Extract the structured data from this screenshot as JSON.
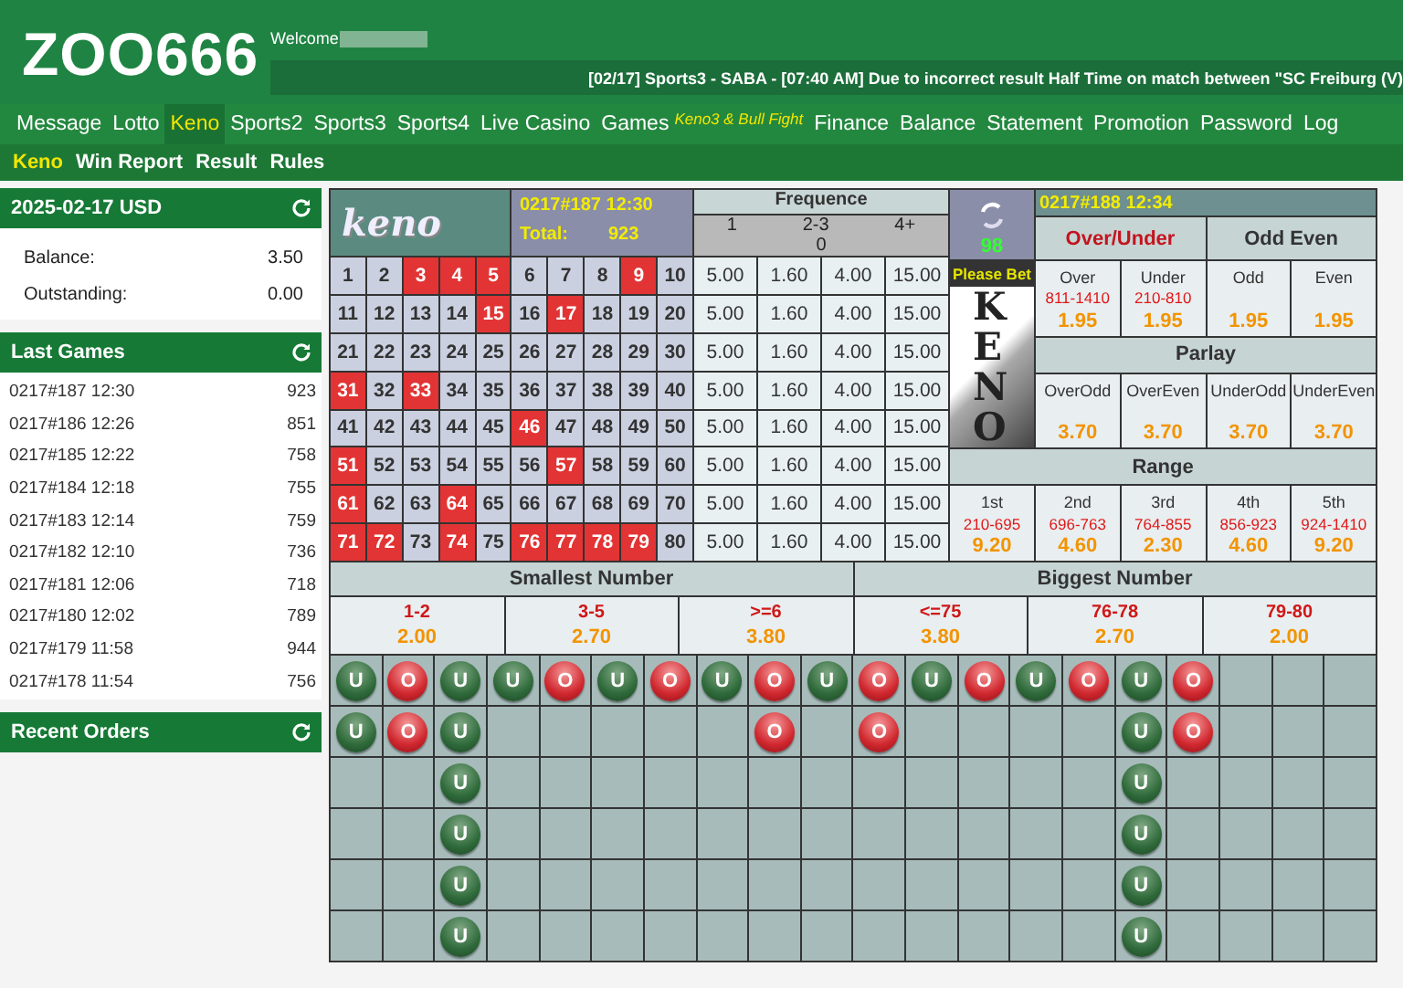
{
  "header": {
    "logo": "ZOO666",
    "welcome": "Welcome",
    "news": "[02/17] Sports3 - SABA - [07:40 AM] Due to incorrect result Half Time on match between \"SC Freiburg (V)"
  },
  "nav": [
    {
      "label": "Message",
      "selected": false
    },
    {
      "label": "Lotto",
      "selected": false
    },
    {
      "label": "Keno",
      "selected": true
    },
    {
      "label": "Sports2",
      "selected": false
    },
    {
      "label": "Sports3",
      "selected": false
    },
    {
      "label": "Sports4",
      "selected": false
    },
    {
      "label": "Live Casino",
      "selected": false
    },
    {
      "label": "Games",
      "selected": false,
      "note": "Keno3 & Bull Fight"
    },
    {
      "label": "Finance",
      "selected": false
    },
    {
      "label": "Balance",
      "selected": false
    },
    {
      "label": "Statement",
      "selected": false
    },
    {
      "label": "Promotion",
      "selected": false
    },
    {
      "label": "Password",
      "selected": false
    },
    {
      "label": "Log",
      "selected": false
    }
  ],
  "subnav": [
    {
      "label": "Keno",
      "selected": true
    },
    {
      "label": "Win Report",
      "selected": false
    },
    {
      "label": "Result",
      "selected": false
    },
    {
      "label": "Rules",
      "selected": false
    }
  ],
  "sidebar": {
    "account": {
      "title": "2025-02-17 USD",
      "rows": [
        {
          "label": "Balance:",
          "value": "3.50"
        },
        {
          "label": "Outstanding:",
          "value": "0.00"
        }
      ]
    },
    "last_games": {
      "title": "Last Games",
      "rows": [
        {
          "draw": "0217#187 12:30",
          "total": "923"
        },
        {
          "draw": "0217#186 12:26",
          "total": "851"
        },
        {
          "draw": "0217#185 12:22",
          "total": "758"
        },
        {
          "draw": "0217#184 12:18",
          "total": "755"
        },
        {
          "draw": "0217#183 12:14",
          "total": "759"
        },
        {
          "draw": "0217#182 12:10",
          "total": "736"
        },
        {
          "draw": "0217#181 12:06",
          "total": "718"
        },
        {
          "draw": "0217#180 12:02",
          "total": "789"
        },
        {
          "draw": "0217#179 11:58",
          "total": "944"
        },
        {
          "draw": "0217#178 11:54",
          "total": "756"
        }
      ]
    },
    "recent_orders": {
      "title": "Recent Orders"
    }
  },
  "board": {
    "logo": "keno",
    "current": {
      "draw": "0217#187 12:30",
      "total_label": "Total:",
      "total": "923"
    },
    "frequence": {
      "title": "Frequence",
      "columns": [
        "1",
        "2-3",
        "4+"
      ],
      "count": "0"
    },
    "numbers": [
      {
        "n": "1",
        "drawn": false
      },
      {
        "n": "2",
        "drawn": false
      },
      {
        "n": "3",
        "drawn": true
      },
      {
        "n": "4",
        "drawn": true
      },
      {
        "n": "5",
        "drawn": true
      },
      {
        "n": "6",
        "drawn": false
      },
      {
        "n": "7",
        "drawn": false
      },
      {
        "n": "8",
        "drawn": false
      },
      {
        "n": "9",
        "drawn": true
      },
      {
        "n": "10",
        "drawn": false
      },
      {
        "n": "11",
        "drawn": false
      },
      {
        "n": "12",
        "drawn": false
      },
      {
        "n": "13",
        "drawn": false
      },
      {
        "n": "14",
        "drawn": false
      },
      {
        "n": "15",
        "drawn": true
      },
      {
        "n": "16",
        "drawn": false
      },
      {
        "n": "17",
        "drawn": true
      },
      {
        "n": "18",
        "drawn": false
      },
      {
        "n": "19",
        "drawn": false
      },
      {
        "n": "20",
        "drawn": false
      },
      {
        "n": "21",
        "drawn": false
      },
      {
        "n": "22",
        "drawn": false
      },
      {
        "n": "23",
        "drawn": false
      },
      {
        "n": "24",
        "drawn": false
      },
      {
        "n": "25",
        "drawn": false
      },
      {
        "n": "26",
        "drawn": false
      },
      {
        "n": "27",
        "drawn": false
      },
      {
        "n": "28",
        "drawn": false
      },
      {
        "n": "29",
        "drawn": false
      },
      {
        "n": "30",
        "drawn": false
      },
      {
        "n": "31",
        "drawn": true
      },
      {
        "n": "32",
        "drawn": false
      },
      {
        "n": "33",
        "drawn": true
      },
      {
        "n": "34",
        "drawn": false
      },
      {
        "n": "35",
        "drawn": false
      },
      {
        "n": "36",
        "drawn": false
      },
      {
        "n": "37",
        "drawn": false
      },
      {
        "n": "38",
        "drawn": false
      },
      {
        "n": "39",
        "drawn": false
      },
      {
        "n": "40",
        "drawn": false
      },
      {
        "n": "41",
        "drawn": false
      },
      {
        "n": "42",
        "drawn": false
      },
      {
        "n": "43",
        "drawn": false
      },
      {
        "n": "44",
        "drawn": false
      },
      {
        "n": "45",
        "drawn": false
      },
      {
        "n": "46",
        "drawn": true
      },
      {
        "n": "47",
        "drawn": false
      },
      {
        "n": "48",
        "drawn": false
      },
      {
        "n": "49",
        "drawn": false
      },
      {
        "n": "50",
        "drawn": false
      },
      {
        "n": "51",
        "drawn": true
      },
      {
        "n": "52",
        "drawn": false
      },
      {
        "n": "53",
        "drawn": false
      },
      {
        "n": "54",
        "drawn": false
      },
      {
        "n": "55",
        "drawn": false
      },
      {
        "n": "56",
        "drawn": false
      },
      {
        "n": "57",
        "drawn": true
      },
      {
        "n": "58",
        "drawn": false
      },
      {
        "n": "59",
        "drawn": false
      },
      {
        "n": "60",
        "drawn": false
      },
      {
        "n": "61",
        "drawn": true
      },
      {
        "n": "62",
        "drawn": false
      },
      {
        "n": "63",
        "drawn": false
      },
      {
        "n": "64",
        "drawn": true
      },
      {
        "n": "65",
        "drawn": false
      },
      {
        "n": "66",
        "drawn": false
      },
      {
        "n": "67",
        "drawn": false
      },
      {
        "n": "68",
        "drawn": false
      },
      {
        "n": "69",
        "drawn": false
      },
      {
        "n": "70",
        "drawn": false
      },
      {
        "n": "71",
        "drawn": true
      },
      {
        "n": "72",
        "drawn": true
      },
      {
        "n": "73",
        "drawn": false
      },
      {
        "n": "74",
        "drawn": true
      },
      {
        "n": "75",
        "drawn": false
      },
      {
        "n": "76",
        "drawn": true
      },
      {
        "n": "77",
        "drawn": true
      },
      {
        "n": "78",
        "drawn": true
      },
      {
        "n": "79",
        "drawn": true
      },
      {
        "n": "80",
        "drawn": false
      }
    ],
    "odds_rows": [
      [
        "5.00",
        "1.60",
        "4.00",
        "15.00"
      ],
      [
        "5.00",
        "1.60",
        "4.00",
        "15.00"
      ],
      [
        "5.00",
        "1.60",
        "4.00",
        "15.00"
      ],
      [
        "5.00",
        "1.60",
        "4.00",
        "15.00"
      ],
      [
        "5.00",
        "1.60",
        "4.00",
        "15.00"
      ],
      [
        "5.00",
        "1.60",
        "4.00",
        "15.00"
      ],
      [
        "5.00",
        "1.60",
        "4.00",
        "15.00"
      ],
      [
        "5.00",
        "1.60",
        "4.00",
        "15.00"
      ]
    ],
    "next": {
      "draw": "0217#188 12:34",
      "countdown": "98",
      "status": "Please Bet",
      "logo_letters": "KENO"
    },
    "over_under": {
      "title": "Over/Under",
      "highlighted": true,
      "options": [
        {
          "label": "Over",
          "range": "811-1410",
          "odds": "1.95"
        },
        {
          "label": "Under",
          "range": "210-810",
          "odds": "1.95"
        }
      ]
    },
    "odd_even": {
      "title": "Odd Even",
      "highlighted": false,
      "options": [
        {
          "label": "Odd",
          "odds": "1.95"
        },
        {
          "label": "Even",
          "odds": "1.95"
        }
      ]
    },
    "parlay": {
      "title": "Parlay",
      "options": [
        {
          "label": "OverOdd",
          "odds": "3.70"
        },
        {
          "label": "OverEven",
          "odds": "3.70"
        },
        {
          "label": "UnderOdd",
          "odds": "3.70"
        },
        {
          "label": "UnderEven",
          "odds": "3.70"
        }
      ]
    },
    "range": {
      "title": "Range",
      "options": [
        {
          "label": "1st",
          "range": "210-695",
          "odds": "9.20"
        },
        {
          "label": "2nd",
          "range": "696-763",
          "odds": "4.60"
        },
        {
          "label": "3rd",
          "range": "764-855",
          "odds": "2.30"
        },
        {
          "label": "4th",
          "range": "856-923",
          "odds": "4.60"
        },
        {
          "label": "5th",
          "range": "924-1410",
          "odds": "9.20"
        }
      ]
    },
    "smallest": {
      "title": "Smallest Number",
      "options": [
        {
          "label": "1-2",
          "odds": "2.00"
        },
        {
          "label": "3-5",
          "odds": "2.70"
        },
        {
          "label": ">=6",
          "odds": "3.80"
        }
      ]
    },
    "biggest": {
      "title": "Biggest Number",
      "options": [
        {
          "label": "<=75",
          "odds": "3.80"
        },
        {
          "label": "76-78",
          "odds": "2.70"
        },
        {
          "label": "79-80",
          "odds": "2.00"
        }
      ]
    }
  },
  "road": [
    [
      {
        "label": "U",
        "kind": "under"
      },
      {
        "label": "U",
        "kind": "under"
      }
    ],
    [
      {
        "label": "O",
        "kind": "over"
      },
      {
        "label": "O",
        "kind": "over"
      }
    ],
    [
      {
        "label": "U",
        "kind": "under"
      },
      {
        "label": "U",
        "kind": "under"
      },
      {
        "label": "U",
        "kind": "under"
      },
      {
        "label": "U",
        "kind": "under"
      },
      {
        "label": "U",
        "kind": "under"
      },
      {
        "label": "U",
        "kind": "under"
      }
    ],
    [
      {
        "label": "U",
        "kind": "under"
      }
    ],
    [
      {
        "label": "O",
        "kind": "over"
      }
    ],
    [
      {
        "label": "U",
        "kind": "under"
      }
    ],
    [
      {
        "label": "O",
        "kind": "over"
      }
    ],
    [
      {
        "label": "U",
        "kind": "under"
      }
    ],
    [
      {
        "label": "O",
        "kind": "over"
      },
      {
        "label": "O",
        "kind": "over"
      }
    ],
    [
      {
        "label": "U",
        "kind": "under"
      }
    ],
    [
      {
        "label": "O",
        "kind": "over"
      },
      {
        "label": "O",
        "kind": "over"
      }
    ],
    [
      {
        "label": "U",
        "kind": "under"
      }
    ],
    [
      {
        "label": "O",
        "kind": "over"
      }
    ],
    [
      {
        "label": "U",
        "kind": "under"
      }
    ],
    [
      {
        "label": "O",
        "kind": "over"
      }
    ],
    [
      {
        "label": "U",
        "kind": "under"
      },
      {
        "label": "U",
        "kind": "under"
      },
      {
        "label": "U",
        "kind": "under"
      },
      {
        "label": "U",
        "kind": "under"
      },
      {
        "label": "U",
        "kind": "under"
      },
      {
        "label": "U",
        "kind": "under"
      }
    ],
    [
      {
        "label": "O",
        "kind": "over"
      },
      {
        "label": "O",
        "kind": "over"
      }
    ]
  ]
}
